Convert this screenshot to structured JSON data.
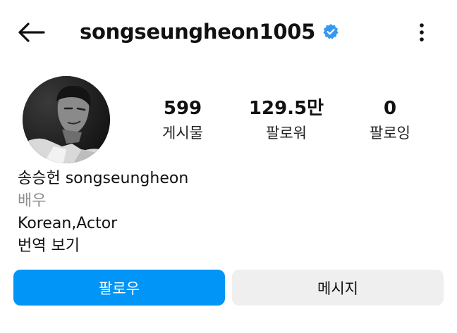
{
  "header": {
    "username": "songseungheon1005",
    "icons": {
      "back": "arrow-left-icon",
      "verified": "verified-badge-icon",
      "more": "more-vertical-icon"
    },
    "verified_color": "#3897f0"
  },
  "stats": [
    {
      "value": "599",
      "label": "게시물"
    },
    {
      "value": "129.5만",
      "label": "팔로워"
    },
    {
      "value": "0",
      "label": "팔로잉"
    }
  ],
  "bio": {
    "name": "송승헌 songseungheon",
    "category": "배우",
    "description": "Korean,Actor",
    "translate_link": "번역 보기"
  },
  "actions": {
    "follow_label": "팔로우",
    "message_label": "메시지"
  },
  "colors": {
    "primary_button": "#0095f6",
    "secondary_button": "#efefef",
    "category_text": "#8e8e8e"
  }
}
